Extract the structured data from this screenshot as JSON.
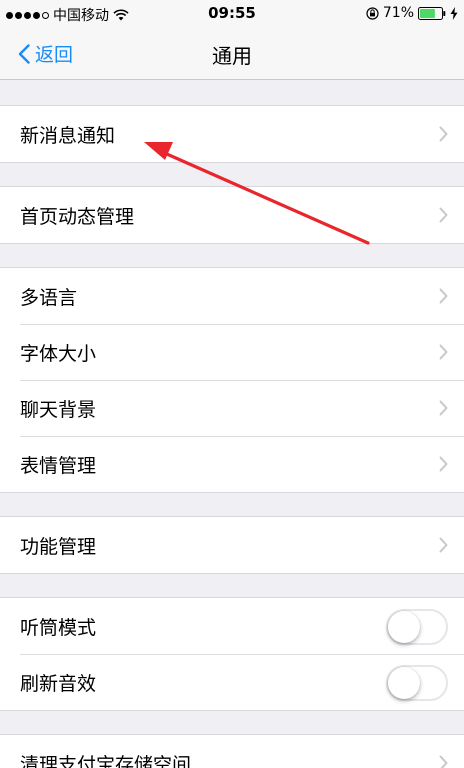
{
  "status_bar": {
    "carrier": "中国移动",
    "time": "09:55",
    "battery_percent": "71%",
    "battery_level": 0.71,
    "signal_bars": 4,
    "signal_max": 5
  },
  "nav": {
    "back_label": "返回",
    "title": "通用"
  },
  "groups": [
    {
      "items": [
        {
          "label": "新消息通知",
          "type": "disclosure"
        }
      ]
    },
    {
      "items": [
        {
          "label": "首页动态管理",
          "type": "disclosure"
        }
      ]
    },
    {
      "items": [
        {
          "label": "多语言",
          "type": "disclosure"
        },
        {
          "label": "字体大小",
          "type": "disclosure"
        },
        {
          "label": "聊天背景",
          "type": "disclosure"
        },
        {
          "label": "表情管理",
          "type": "disclosure"
        }
      ]
    },
    {
      "items": [
        {
          "label": "功能管理",
          "type": "disclosure"
        }
      ]
    },
    {
      "items": [
        {
          "label": "听筒模式",
          "type": "toggle",
          "on": false
        },
        {
          "label": "刷新音效",
          "type": "toggle",
          "on": false
        }
      ]
    },
    {
      "items": [
        {
          "label": "清理支付宝存储空间",
          "type": "disclosure"
        }
      ]
    }
  ],
  "colors": {
    "accent": "#1a8cf6",
    "background": "#efeff4",
    "annotation": "#e8262b",
    "battery": "#4cd964"
  },
  "icons": [
    "wifi-icon",
    "lock-rotation-icon",
    "battery-icon",
    "charging-icon",
    "chevron-left-icon",
    "chevron-right-icon"
  ]
}
